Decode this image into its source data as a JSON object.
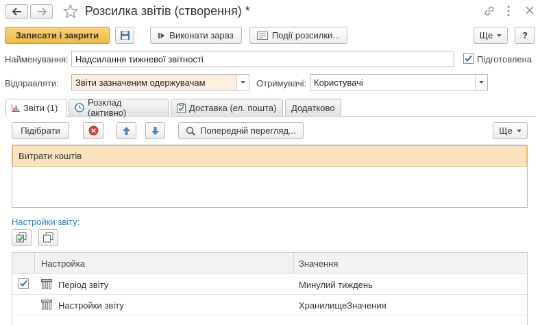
{
  "window": {
    "title": "Розсилка звітів (створення) *"
  },
  "toolbar": {
    "save_close_label": "Записати і закрити",
    "run_now_label": "Виконати зараз",
    "events_label": "Події розсилки...",
    "more_label": "Ще",
    "help_label": "?"
  },
  "form": {
    "name_label": "Найменування:",
    "name_value": "Надсилання тижневої звітності",
    "prepared_label": "Підготовлена",
    "prepared_checked": true,
    "send_label": "Відправляти:",
    "send_value": "Звіти зазначеним одержувачам",
    "recipients_label": "Отримувачі:",
    "recipients_value": "Користувачі"
  },
  "tabs": [
    {
      "label": "Звіти (1)",
      "icon": "bar-chart-icon",
      "active": true
    },
    {
      "label": "Розклад (активно)",
      "icon": "clock-icon",
      "active": false
    },
    {
      "label": "Доставка (ел. пошта)",
      "icon": "clipboard-check-icon",
      "active": false
    },
    {
      "label": "Додатково",
      "icon": "",
      "active": false
    }
  ],
  "reports_panel": {
    "pick_label": "Підібрати",
    "preview_label": "Попередній перегляд...",
    "more_label": "Ще",
    "reports": [
      "Витрати коштів"
    ]
  },
  "settings": {
    "heading": "Настройки звіту:",
    "columns": [
      "Настройка",
      "Значення"
    ],
    "rows": [
      {
        "checked": true,
        "name": "Період звіту",
        "value": "Минулий тиждень"
      },
      {
        "checked": false,
        "name": "Настройки звіту",
        "value": "ХранилищеЗначения"
      }
    ]
  },
  "colors": {
    "accent_orange": "#f0b93e",
    "selected_row": "#fbe3bd",
    "link_blue": "#2b87c6",
    "delete_red": "#d9382f"
  }
}
